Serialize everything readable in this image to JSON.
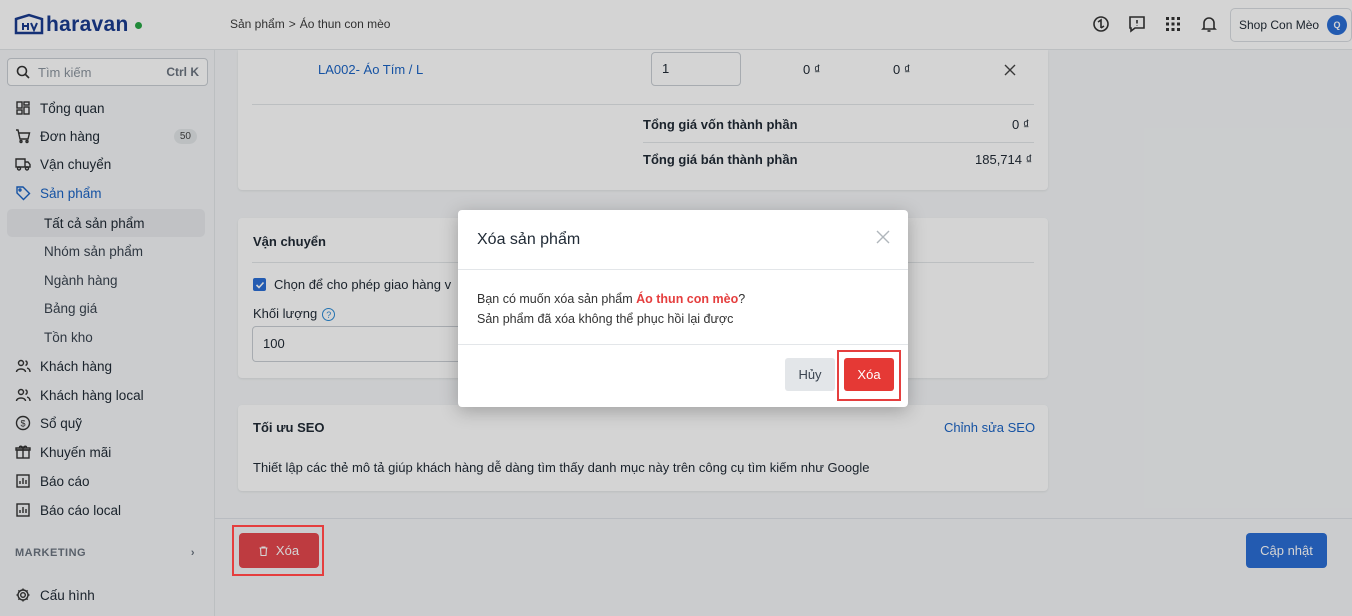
{
  "app": {
    "logo_text": "haravan",
    "online_color": "#28a745"
  },
  "breadcrumb": {
    "parent": "Sản phẩm",
    "separator": ">",
    "current": "Áo thun con mèo"
  },
  "header": {
    "shop_name": "Shop Con Mèo",
    "avatar_initial": "Q"
  },
  "sidebar": {
    "search_placeholder": "Tìm kiếm",
    "search_shortcut": "Ctrl K",
    "items": [
      {
        "label": "Tổng quan",
        "icon": "dashboard-icon"
      },
      {
        "label": "Đơn hàng",
        "icon": "cart-icon",
        "badge": "50"
      },
      {
        "label": "Vận chuyển",
        "icon": "truck-icon"
      },
      {
        "label": "Sản phẩm",
        "icon": "tag-icon"
      },
      {
        "label": "Khách hàng",
        "icon": "users-icon"
      },
      {
        "label": "Khách hàng local",
        "icon": "users-icon"
      },
      {
        "label": "Sổ quỹ",
        "icon": "dollar-icon"
      },
      {
        "label": "Khuyến mãi",
        "icon": "gift-icon"
      },
      {
        "label": "Báo cáo",
        "icon": "report-icon"
      },
      {
        "label": "Báo cáo local",
        "icon": "report-icon"
      }
    ],
    "sub_items": [
      {
        "label": "Tất cả sản phẩm"
      },
      {
        "label": "Nhóm sản phẩm"
      },
      {
        "label": "Ngành hàng"
      },
      {
        "label": "Bảng giá"
      },
      {
        "label": "Tồn kho"
      }
    ],
    "section_marketing": "MARKETING",
    "settings_label": "Cấu hình"
  },
  "components": {
    "variant_name": "LA002- Áo Tím / L",
    "quantity": "1",
    "cost": "0 ₫",
    "price": "0 ₫",
    "total_cost_label": "Tổng giá vốn thành phần",
    "total_cost_value": "0 ₫",
    "total_price_label": "Tổng giá bán thành phần",
    "total_price_value": "185,714 ₫"
  },
  "shipping": {
    "title": "Vận chuyển",
    "checkbox_label": "Chọn để cho phép giao hàng v",
    "weight_label": "Khối lượng",
    "weight_value": "100"
  },
  "seo": {
    "title": "Tối ưu SEO",
    "edit_link": "Chỉnh sửa SEO",
    "description": "Thiết lập các thẻ mô tả giúp khách hàng dễ dàng tìm thấy danh mục này trên công cụ tìm kiếm như Google"
  },
  "footer": {
    "delete_label": "Xóa",
    "update_label": "Cập nhật"
  },
  "modal": {
    "title": "Xóa sản phẩm",
    "question_prefix": "Bạn có muốn xóa sản phẩm ",
    "product_name": "Áo thun con mèo",
    "question_suffix": "?",
    "warning": "Sản phẩm đã xóa không thể phục hồi lại được",
    "cancel_label": "Hủy",
    "confirm_label": "Xóa"
  },
  "colors": {
    "primary": "#2b6ed5",
    "danger": "#e53935",
    "highlight_frame": "#e53e3e"
  }
}
